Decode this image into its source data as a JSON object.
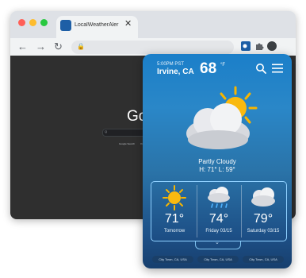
{
  "browser": {
    "tab_title": "LocalWeatherAler",
    "tab_close": "✕",
    "google_logo": "Go",
    "search_small": "Q",
    "google_buttons": [
      "Google Search",
      "I'm Feeling Lucky"
    ],
    "nav": {
      "back": "←",
      "forward": "→",
      "reload": "↻"
    },
    "extensions": [
      "weather-app-icon",
      "puzzle-icon",
      "profile-icon"
    ]
  },
  "widget": {
    "time": "5:00PM PST",
    "city": "Irvine, CA",
    "temp": "68",
    "temp_unit": "°F",
    "condition": "Partly Cloudy",
    "hilo": "H: 71°  L: 59°",
    "forecast": [
      {
        "temp": "71°",
        "label": "Tomorrow",
        "icon": "sunny-icon"
      },
      {
        "temp": "74°",
        "label": "Friday 03/15",
        "icon": "rain-cloud-icon"
      },
      {
        "temp": "79°",
        "label": "Saturday 03/15",
        "icon": "cloudy-icon"
      }
    ],
    "locations": [
      "City Town, CA, USA",
      "City Town, CA, USA",
      "City Town, CA, USA"
    ],
    "expand": "⌄"
  },
  "colors": {
    "widget_top": "#1b7fc9",
    "widget_bottom": "#173f6e",
    "forecast_border": "#8fd0ff",
    "sun": "#f7b500"
  }
}
